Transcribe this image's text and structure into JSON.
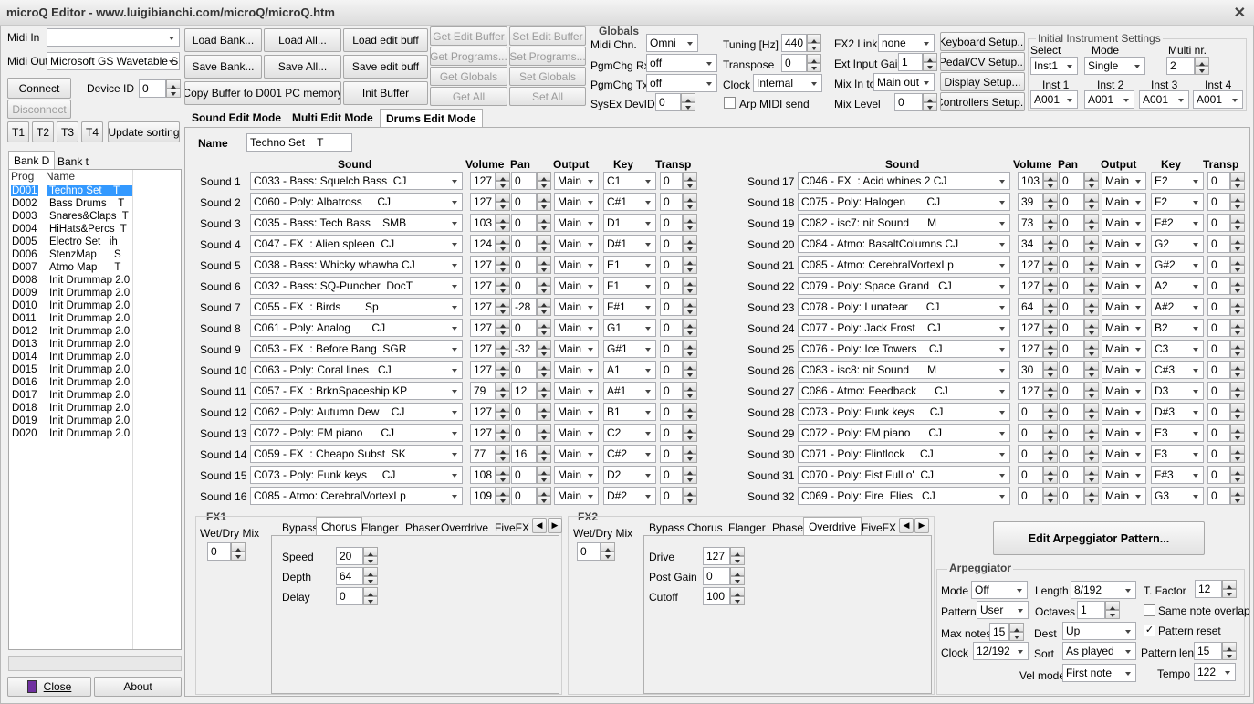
{
  "window": {
    "title": "microQ Editor - www.luigibianchi.com/microQ/microQ.htm",
    "close": "✕"
  },
  "left": {
    "midi_in_label": "Midi In",
    "midi_in_value": "",
    "midi_out_label": "Midi Out",
    "midi_out_value": "Microsoft GS Wavetable S",
    "connect": "Connect",
    "disconnect": "Disconnect",
    "device_id_label": "Device ID",
    "device_id": "0",
    "t_buttons": [
      "T1",
      "T2",
      "T3",
      "T4"
    ],
    "update_sorting": "Update sorting",
    "bank_tabs": [
      "Bank D",
      "Bank t"
    ],
    "list_headers": [
      "Prog",
      "Name"
    ],
    "programs": [
      [
        "D001",
        "Techno Set    T"
      ],
      [
        "D002",
        "Bass Drums    T"
      ],
      [
        "D003",
        "Snares&Claps  T"
      ],
      [
        "D004",
        "HiHats&Percs  T"
      ],
      [
        "D005",
        "Electro Set   ih"
      ],
      [
        "D006",
        "StenzMap      S"
      ],
      [
        "D007",
        "Atmo Map      T"
      ],
      [
        "D008",
        "Init Drummap 2.0"
      ],
      [
        "D009",
        "Init Drummap 2.0"
      ],
      [
        "D010",
        "Init Drummap 2.0"
      ],
      [
        "D011",
        "Init Drummap 2.0"
      ],
      [
        "D012",
        "Init Drummap 2.0"
      ],
      [
        "D013",
        "Init Drummap 2.0"
      ],
      [
        "D014",
        "Init Drummap 2.0"
      ],
      [
        "D015",
        "Init Drummap 2.0"
      ],
      [
        "D016",
        "Init Drummap 2.0"
      ],
      [
        "D017",
        "Init Drummap 2.0"
      ],
      [
        "D018",
        "Init Drummap 2.0"
      ],
      [
        "D019",
        "Init Drummap 2.0"
      ],
      [
        "D020",
        "Init Drummap 2.0"
      ]
    ],
    "close": "Close",
    "about": "About"
  },
  "toolbar": {
    "load_bank": "Load Bank...",
    "load_all": "Load All...",
    "load_edit_buff": "Load edit buff",
    "save_bank": "Save Bank...",
    "save_all": "Save All...",
    "save_edit_buff": "Save edit buff",
    "copy_buffer": "Copy Buffer to D001 PC memory",
    "init_buffer": "Init Buffer",
    "get_edit_buffer": "Get Edit Buffer",
    "set_edit_buffer": "Set Edit Buffer",
    "get_programs": "Get Programs...",
    "set_programs": "Set Programs...",
    "get_globals": "Get Globals",
    "set_globals": "Set Globals",
    "get_all": "Get All",
    "set_all": "Set All"
  },
  "globals": {
    "title": "Globals",
    "midi_chn_label": "Midi Chn.",
    "midi_chn": "Omni",
    "pgmchg_rx_label": "PgmChg Rx",
    "pgmchg_rx": "off",
    "pgmchg_tx_label": "PgmChg Tx",
    "pgmchg_tx": "off",
    "sysex_label": "SysEx DevID",
    "sysex": "0",
    "tuning_label": "Tuning [Hz]",
    "tuning": "440",
    "transpose_label": "Transpose",
    "transpose": "0",
    "clock_label": "Clock",
    "clock": "Internal",
    "arp_midi_send": "Arp MIDI send",
    "fx2_link_label": "FX2 Link",
    "fx2_link": "none",
    "ext_input_gain_label": "Ext Input Gain",
    "ext_input_gain": "1",
    "mix_in_to_label": "Mix In to",
    "mix_in_to": "Main out",
    "mix_level_label": "Mix Level",
    "mix_level": "0"
  },
  "setup": {
    "keyboard": "Keyboard Setup...",
    "pedal": "Pedal/CV Setup...",
    "display": "Display Setup...",
    "controllers": "Controllers Setup..."
  },
  "instrument": {
    "title": "Initial Instrument Settings",
    "select_label": "Select",
    "select": "Inst1",
    "mode_label": "Mode",
    "mode": "Single",
    "multi_label": "Multi nr.",
    "multi": "2",
    "inst_labels": [
      "Inst 1",
      "Inst 2",
      "Inst 3",
      "Inst 4"
    ],
    "inst_values": [
      "A001",
      "A001",
      "A001",
      "A001"
    ]
  },
  "modes": [
    "Sound Edit Mode",
    "Multi Edit Mode",
    "Drums Edit Mode"
  ],
  "drum": {
    "name_label": "Name",
    "name": "Techno Set    T",
    "headers": [
      "Sound",
      "Volume",
      "Pan",
      "Output",
      "Key",
      "Transp"
    ],
    "sounds": [
      [
        "Sound 1",
        "C033 - Bass: Squelch Bass  CJ",
        "127",
        "0",
        "Main",
        "C1",
        "0"
      ],
      [
        "Sound 2",
        "C060 - Poly: Albatross     CJ",
        "127",
        "0",
        "Main",
        "C#1",
        "0"
      ],
      [
        "Sound 3",
        "C035 - Bass: Tech Bass    SMB",
        "103",
        "0",
        "Main",
        "D1",
        "0"
      ],
      [
        "Sound 4",
        "C047 - FX  : Alien spleen  CJ",
        "124",
        "0",
        "Main",
        "D#1",
        "0"
      ],
      [
        "Sound 5",
        "C038 - Bass: Whicky whawha CJ",
        "127",
        "0",
        "Main",
        "E1",
        "0"
      ],
      [
        "Sound 6",
        "C032 - Bass: SQ-Puncher  DocT",
        "127",
        "0",
        "Main",
        "F1",
        "0"
      ],
      [
        "Sound 7",
        "C055 - FX  : Birds        Sp",
        "127",
        "-28",
        "Main",
        "F#1",
        "0"
      ],
      [
        "Sound 8",
        "C061 - Poly: Analog       CJ",
        "127",
        "0",
        "Main",
        "G1",
        "0"
      ],
      [
        "Sound 9",
        "C053 - FX  : Before Bang  SGR",
        "127",
        "-32",
        "Main",
        "G#1",
        "0"
      ],
      [
        "Sound 10",
        "C063 - Poly: Coral lines   CJ",
        "127",
        "0",
        "Main",
        "A1",
        "0"
      ],
      [
        "Sound 11",
        "C057 - FX  : BrknSpaceship KP",
        "79",
        "12",
        "Main",
        "A#1",
        "0"
      ],
      [
        "Sound 12",
        "C062 - Poly: Autumn Dew    CJ",
        "127",
        "0",
        "Main",
        "B1",
        "0"
      ],
      [
        "Sound 13",
        "C072 - Poly: FM piano      CJ",
        "127",
        "0",
        "Main",
        "C2",
        "0"
      ],
      [
        "Sound 14",
        "C059 - FX  : Cheapo Subst  SK",
        "77",
        "16",
        "Main",
        "C#2",
        "0"
      ],
      [
        "Sound 15",
        "C073 - Poly: Funk keys     CJ",
        "108",
        "0",
        "Main",
        "D2",
        "0"
      ],
      [
        "Sound 16",
        "C085 - Atmo: CerebralVortexLp",
        "109",
        "0",
        "Main",
        "D#2",
        "0"
      ],
      [
        "Sound 17",
        "C046 - FX  : Acid whines 2 CJ",
        "103",
        "0",
        "Main",
        "E2",
        "0"
      ],
      [
        "Sound 18",
        "C075 - Poly: Halogen       CJ",
        "39",
        "0",
        "Main",
        "F2",
        "0"
      ],
      [
        "Sound 19",
        "C082 - isc7: nit Sound      M",
        "73",
        "0",
        "Main",
        "F#2",
        "0"
      ],
      [
        "Sound 20",
        "C084 - Atmo: BasaltColumns CJ",
        "34",
        "0",
        "Main",
        "G2",
        "0"
      ],
      [
        "Sound 21",
        "C085 - Atmo: CerebralVortexLp",
        "127",
        "0",
        "Main",
        "G#2",
        "0"
      ],
      [
        "Sound 22",
        "C079 - Poly: Space Grand   CJ",
        "127",
        "0",
        "Main",
        "A2",
        "0"
      ],
      [
        "Sound 23",
        "C078 - Poly: Lunatear      CJ",
        "64",
        "0",
        "Main",
        "A#2",
        "0"
      ],
      [
        "Sound 24",
        "C077 - Poly: Jack Frost    CJ",
        "127",
        "0",
        "Main",
        "B2",
        "0"
      ],
      [
        "Sound 25",
        "C076 - Poly: Ice Towers    CJ",
        "127",
        "0",
        "Main",
        "C3",
        "0"
      ],
      [
        "Sound 26",
        "C083 - isc8: nit Sound      M",
        "30",
        "0",
        "Main",
        "C#3",
        "0"
      ],
      [
        "Sound 27",
        "C086 - Atmo: Feedback      CJ",
        "127",
        "0",
        "Main",
        "D3",
        "0"
      ],
      [
        "Sound 28",
        "C073 - Poly: Funk keys     CJ",
        "0",
        "0",
        "Main",
        "D#3",
        "0"
      ],
      [
        "Sound 29",
        "C072 - Poly: FM piano      CJ",
        "0",
        "0",
        "Main",
        "E3",
        "0"
      ],
      [
        "Sound 30",
        "C071 - Poly: Flintlock     CJ",
        "0",
        "0",
        "Main",
        "F3",
        "0"
      ],
      [
        "Sound 31",
        "C070 - Poly: Fist Full o'  CJ",
        "0",
        "0",
        "Main",
        "F#3",
        "0"
      ],
      [
        "Sound 32",
        "C069 - Poly: Fire  Flies   CJ",
        "0",
        "0",
        "Main",
        "G3",
        "0"
      ]
    ]
  },
  "fx1": {
    "title": "FX1",
    "wetdry_label": "Wet/Dry Mix",
    "wetdry": "0",
    "tabs": [
      "Bypass",
      "Chorus",
      "Flanger",
      "Phaser",
      "Overdrive",
      "FiveFX"
    ],
    "active": 1,
    "params": [
      [
        "Speed",
        "20"
      ],
      [
        "Depth",
        "64"
      ],
      [
        "Delay",
        "0"
      ]
    ]
  },
  "fx2": {
    "title": "FX2",
    "wetdry_label": "Wet/Dry Mix",
    "wetdry": "0",
    "tabs": [
      "Bypass",
      "Chorus",
      "Flanger",
      "Phaser",
      "Overdrive",
      "FiveFX"
    ],
    "active": 4,
    "params": [
      [
        "Drive",
        "127"
      ],
      [
        "Post Gain",
        "0"
      ],
      [
        "Cutoff",
        "100"
      ]
    ]
  },
  "arp": {
    "edit_pattern": "Edit Arpeggiator Pattern...",
    "title": "Arpeggiator",
    "mode_label": "Mode",
    "mode": "Off",
    "length_label": "Length",
    "length": "8/192",
    "tfactor_label": "T. Factor",
    "tfactor": "12",
    "pattern_label": "Pattern",
    "pattern": "User",
    "octaves_label": "Octaves",
    "octaves": "1",
    "same_note": "Same note overlap",
    "maxnotes_label": "Max notes",
    "maxnotes": "15",
    "dest_label": "Dest",
    "dest": "Up",
    "pattern_reset": "Pattern reset",
    "clock_label": "Clock",
    "clock": "12/192",
    "sort_label": "Sort",
    "sort": "As played",
    "patlen_label": "Pattern len",
    "patlen": "15",
    "velmode_label": "Vel mode",
    "velmode": "First note",
    "tempo_label": "Tempo",
    "tempo": "122",
    "check": "✓"
  }
}
